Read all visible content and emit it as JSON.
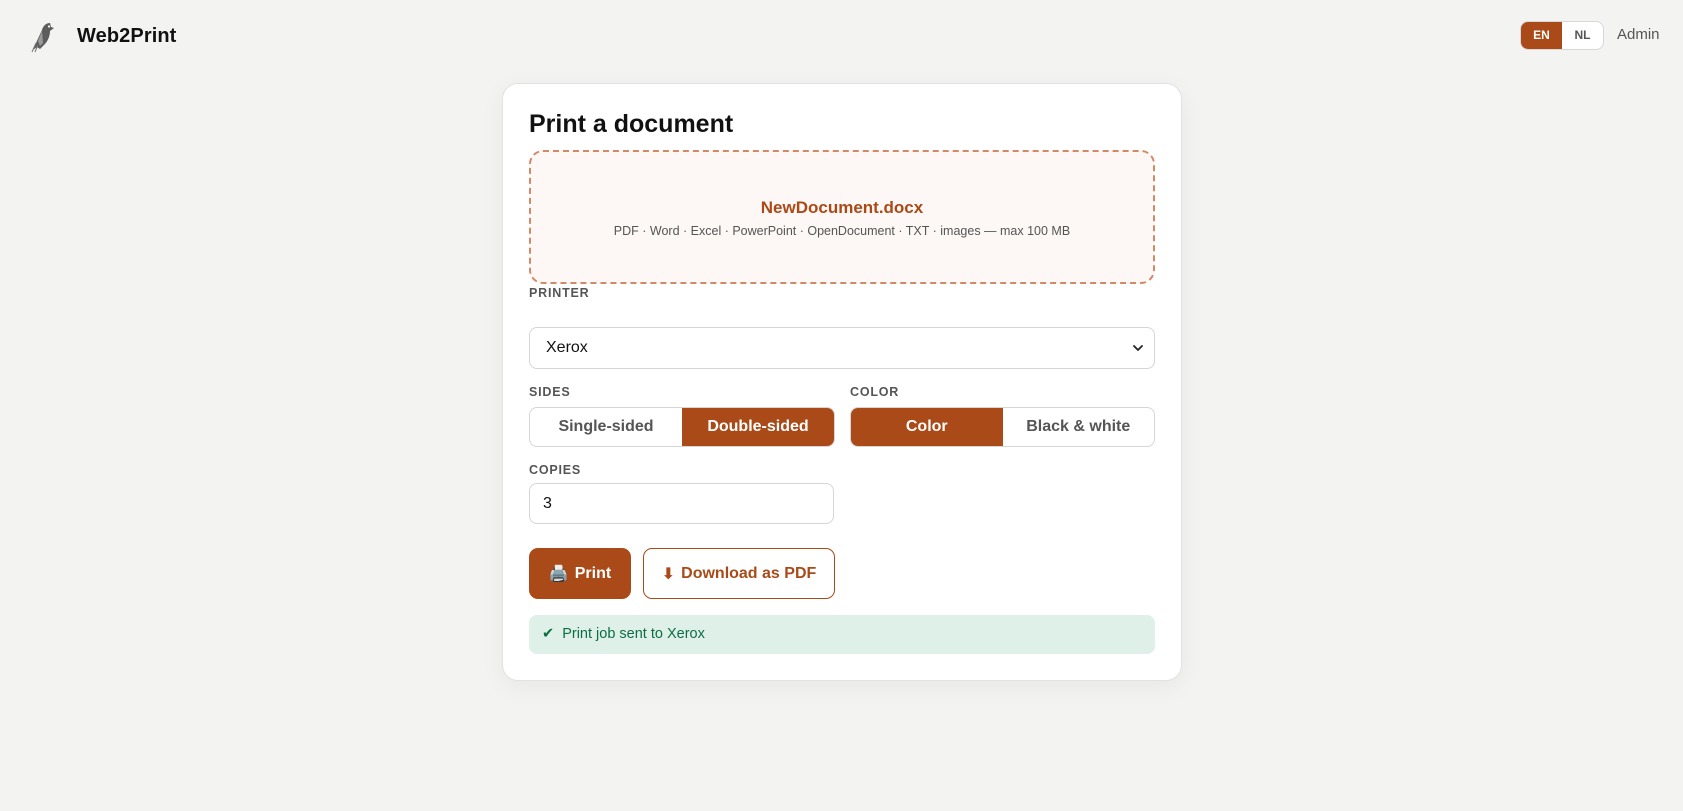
{
  "app": {
    "name": "Web2Print",
    "logo_icon": "bird-logo-icon"
  },
  "header": {
    "languages": [
      {
        "code": "EN",
        "active": true
      },
      {
        "code": "NL",
        "active": false
      }
    ],
    "admin_label": "Admin"
  },
  "form": {
    "title": "Print a document",
    "upload": {
      "file_name": "NewDocument.docx",
      "hint": "PDF · Word · Excel · PowerPoint · OpenDocument · TXT · images — max 100 MB"
    },
    "printer": {
      "label": "PRINTER",
      "selected": "Xerox"
    },
    "sides": {
      "label": "SIDES",
      "options": [
        {
          "label": "Single-sided",
          "active": false
        },
        {
          "label": "Double-sided",
          "active": true
        }
      ]
    },
    "color": {
      "label": "COLOR",
      "options": [
        {
          "label": "Color",
          "active": true
        },
        {
          "label": "Black & white",
          "active": false
        }
      ]
    },
    "copies": {
      "label": "COPIES",
      "value": "3"
    },
    "print_button": {
      "icon": "🖨️",
      "label": "Print"
    },
    "download_button": {
      "icon": "⬇",
      "label": "Download as PDF"
    },
    "status": {
      "icon": "✔",
      "message": "Print job sent to Xerox"
    }
  },
  "colors": {
    "accent": "#a94a18",
    "success_bg": "#def0e8",
    "success_text": "#0d6e45"
  }
}
